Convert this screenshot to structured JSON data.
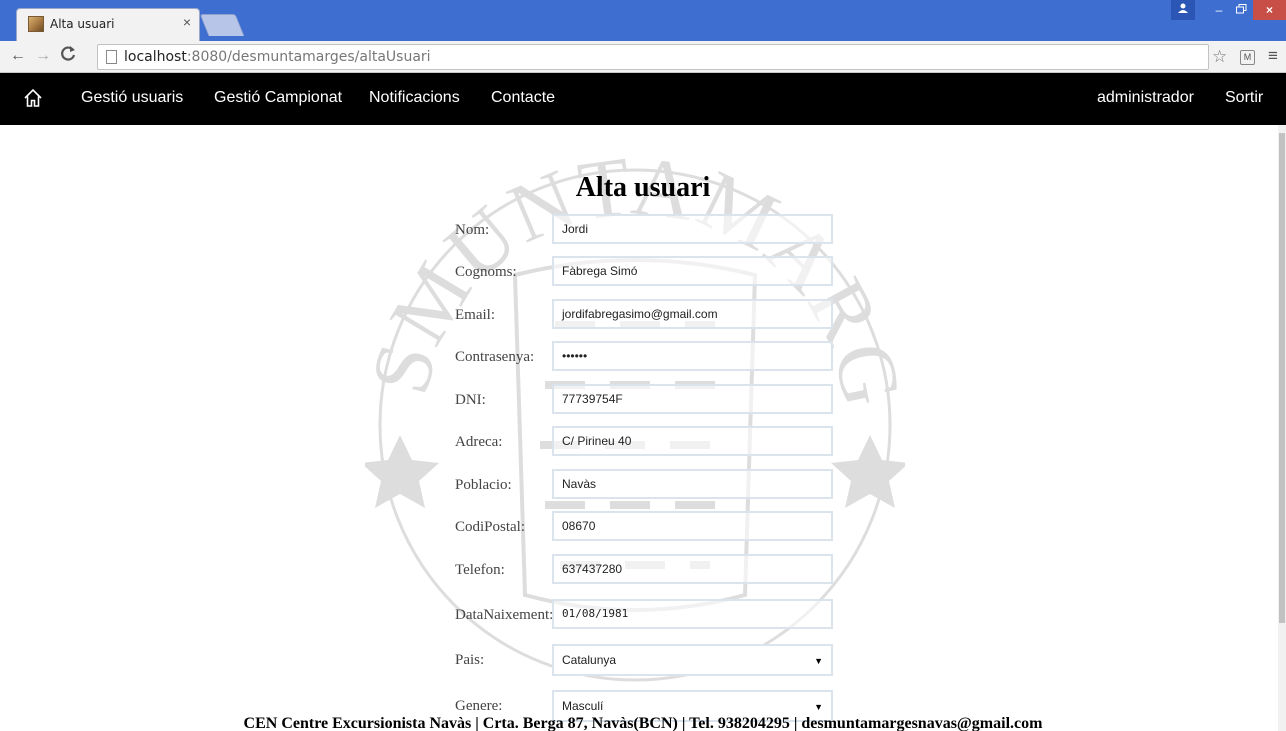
{
  "browser": {
    "tab_title": "Alta usuari",
    "tab_close": "×",
    "url_host": "localhost",
    "url_path": ":8080/desmuntamarges/altaUsuari",
    "window_close": "×",
    "window_minimize": "–"
  },
  "navbar": {
    "links": [
      "Gestió usuaris",
      "Gestió Campionat",
      "Notificacions",
      "Contacte"
    ],
    "user": "administrador",
    "logout": "Sortir"
  },
  "form": {
    "title": "Alta usuari",
    "fields": [
      {
        "label": "Nom:",
        "value": "Jordi"
      },
      {
        "label": "Cognoms:",
        "value": "Fàbrega Simó"
      },
      {
        "label": "Email:",
        "value": "jordifabregasimo@gmail.com"
      },
      {
        "label": "Contrasenya:",
        "value": "••••••"
      },
      {
        "label": "DNI:",
        "value": "77739754F"
      },
      {
        "label": "Adreca:",
        "value": "C/ Pirineu 40"
      },
      {
        "label": "Poblacio:",
        "value": "Navàs"
      },
      {
        "label": "CodiPostal:",
        "value": "08670"
      },
      {
        "label": "Telefon:",
        "value": "637437280"
      },
      {
        "label": "DataNaixement:",
        "value": "01/08/1981"
      },
      {
        "label": "Pais:",
        "value": "Catalunya"
      },
      {
        "label": "Genere:",
        "value": "Masculí"
      }
    ]
  },
  "watermark": {
    "text_top": "DESMUNTAMARGES"
  },
  "footer": {
    "text": "CEN Centre Excursionista Navàs | Crta. Berga 87, Navàs(BCN) | Tel. 938204295 | desmuntamargesnavas@gmail.com"
  },
  "colors": {
    "navbar_bg": "#000000",
    "titlebar_bg": "#3f6ed1",
    "input_border": "#dbe4ec"
  }
}
